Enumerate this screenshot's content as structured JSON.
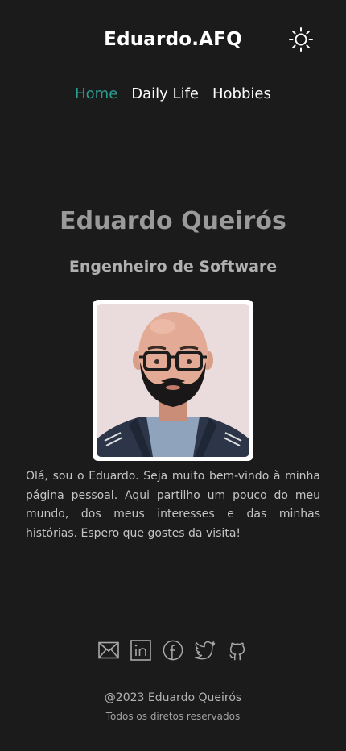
{
  "header": {
    "brand": "Eduardo.AFQ",
    "theme_toggle_icon": "sun-icon"
  },
  "nav": {
    "items": [
      {
        "label": "Home",
        "active": true
      },
      {
        "label": "Daily Life",
        "active": false
      },
      {
        "label": "Hobbies",
        "active": false
      }
    ]
  },
  "profile": {
    "name": "Eduardo Queirós",
    "role": "Engenheiro de Software",
    "intro": "Olá, sou o Eduardo. Seja muito bem-vindo à minha página pessoal. Aqui partilho um pouco do meu mundo, dos meus interesses e das minhas histórias. Espero que gostes da visita!"
  },
  "social": {
    "icons": [
      "email-icon",
      "linkedin-icon",
      "facebook-icon",
      "twitter-icon",
      "github-icon"
    ]
  },
  "footer": {
    "copyright": "@2023 Eduardo Queirós",
    "rights": "Todos os diretos reservados"
  },
  "colors": {
    "background": "#1c1b1c",
    "accent": "#2a9d8f",
    "icon": "#a8a8a8"
  }
}
